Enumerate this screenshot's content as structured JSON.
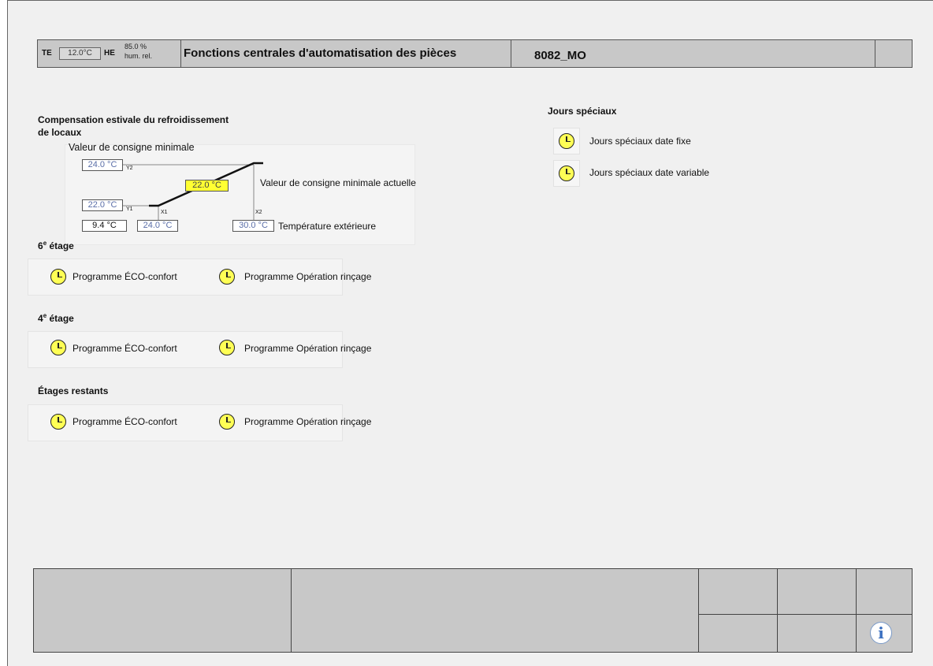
{
  "header": {
    "te_label": "TE",
    "te_value": "12.0°C",
    "he_label": "HE",
    "he_value": "85.0 %",
    "he_unit": "hum. rel.",
    "title": "Fonctions centrales d'automatisation des pièces",
    "code": "8082_MO"
  },
  "compensation": {
    "title_line1": "Compensation estivale du refroidissement",
    "title_line2": "de locaux",
    "min_setpoint_label": "Valeur de consigne minimale",
    "y2_value": "24.0 °C",
    "y2_label": "Y2",
    "current_value": "22.0 °C",
    "current_label": "Valeur de consigne minimale actuelle",
    "y1_value": "22.0 °C",
    "y1_label": "Y1",
    "x1_label": "X1",
    "x2_label": "X2",
    "outside_value": "9.4 °C",
    "x1_value": "24.0 °C",
    "x2_value": "30.0 °C",
    "outside_label": "Température extérieure"
  },
  "floors": [
    {
      "title_num": "6",
      "title_sup": "e",
      "title_rest": " étage",
      "eco": "Programme ÉCO-confort",
      "flush": "Programme Opération rinçage"
    },
    {
      "title_num": "4",
      "title_sup": "e",
      "title_rest": " étage",
      "eco": "Programme ÉCO-confort",
      "flush": "Programme Opération rinçage"
    },
    {
      "title_num": "Étages restants",
      "title_sup": "",
      "title_rest": "",
      "eco": "Programme ÉCO-confort",
      "flush": "Programme Opération rinçage"
    }
  ],
  "special_days": {
    "title": "Jours spéciaux",
    "fixed": "Jours spéciaux date fixe",
    "variable": "Jours spéciaux date variable"
  },
  "colors": {
    "panel_bg": "#f0f0f0",
    "bar_bg": "#c8c8c8",
    "clock_yellow": "#ffff55",
    "highlight_yellow": "#ffff33",
    "value_blue": "#5a6ea8"
  },
  "icons": [
    "clock-icon",
    "info-icon"
  ]
}
